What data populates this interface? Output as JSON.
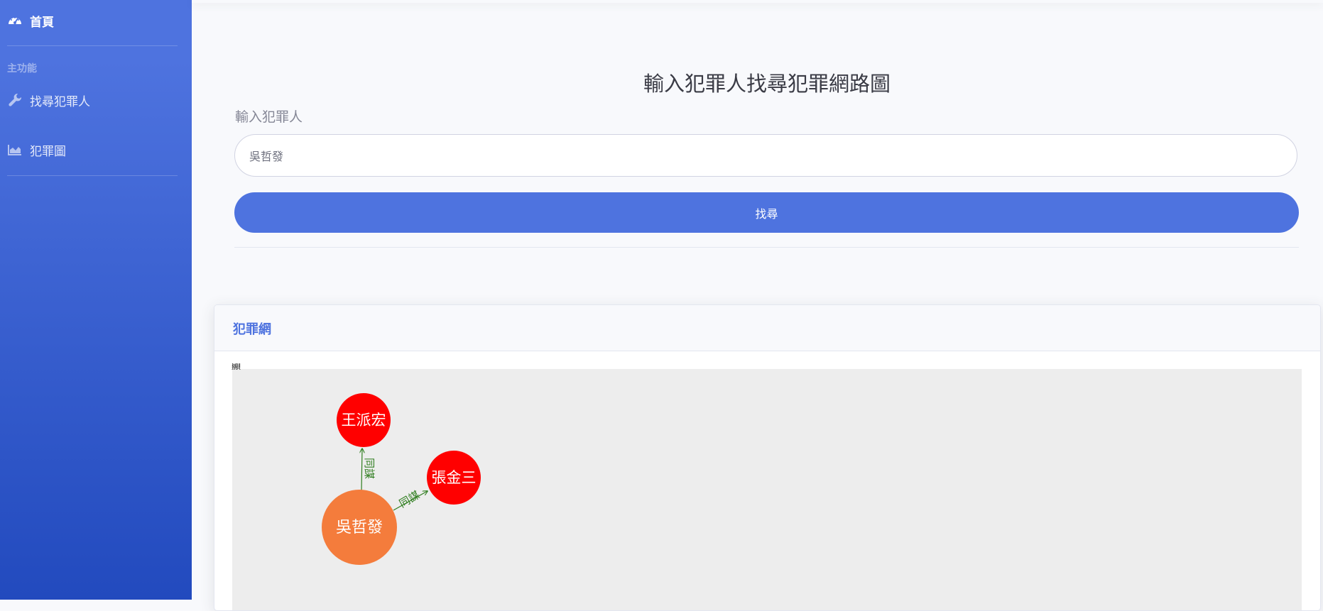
{
  "sidebar": {
    "home_label": "首頁",
    "section_heading": "主功能",
    "items": [
      {
        "label": "找尋犯罪人",
        "icon": "wrench-icon"
      },
      {
        "label": "犯罪圖",
        "icon": "area-chart-icon"
      }
    ],
    "home_icon": "dashboard-icon"
  },
  "main": {
    "title": "輸入犯罪人找尋犯罪網路圖",
    "input_label": "輸入犯罪人",
    "input_value": "吳哲發",
    "search_button": "找尋"
  },
  "card": {
    "title": "犯罪網",
    "corner_text": "顯",
    "graph": {
      "nodes": [
        {
          "id": "wu",
          "label": "吳哲發",
          "color": "#f47c3c",
          "role": "center"
        },
        {
          "id": "wang",
          "label": "王派宏",
          "color": "#ff0000",
          "role": "associate"
        },
        {
          "id": "zhang",
          "label": "張金三",
          "color": "#ff0000",
          "role": "associate"
        }
      ],
      "edges": [
        {
          "from": "wu",
          "to": "wang",
          "label": "同謀"
        },
        {
          "from": "wu",
          "to": "zhang",
          "label": "同謀"
        }
      ],
      "edge_color": "#2e7d1e"
    }
  },
  "colors": {
    "accent": "#4e73df",
    "sidebar_gradient_top": "#4e73df",
    "sidebar_gradient_bottom": "#224abe",
    "graph_background": "#ededed"
  }
}
